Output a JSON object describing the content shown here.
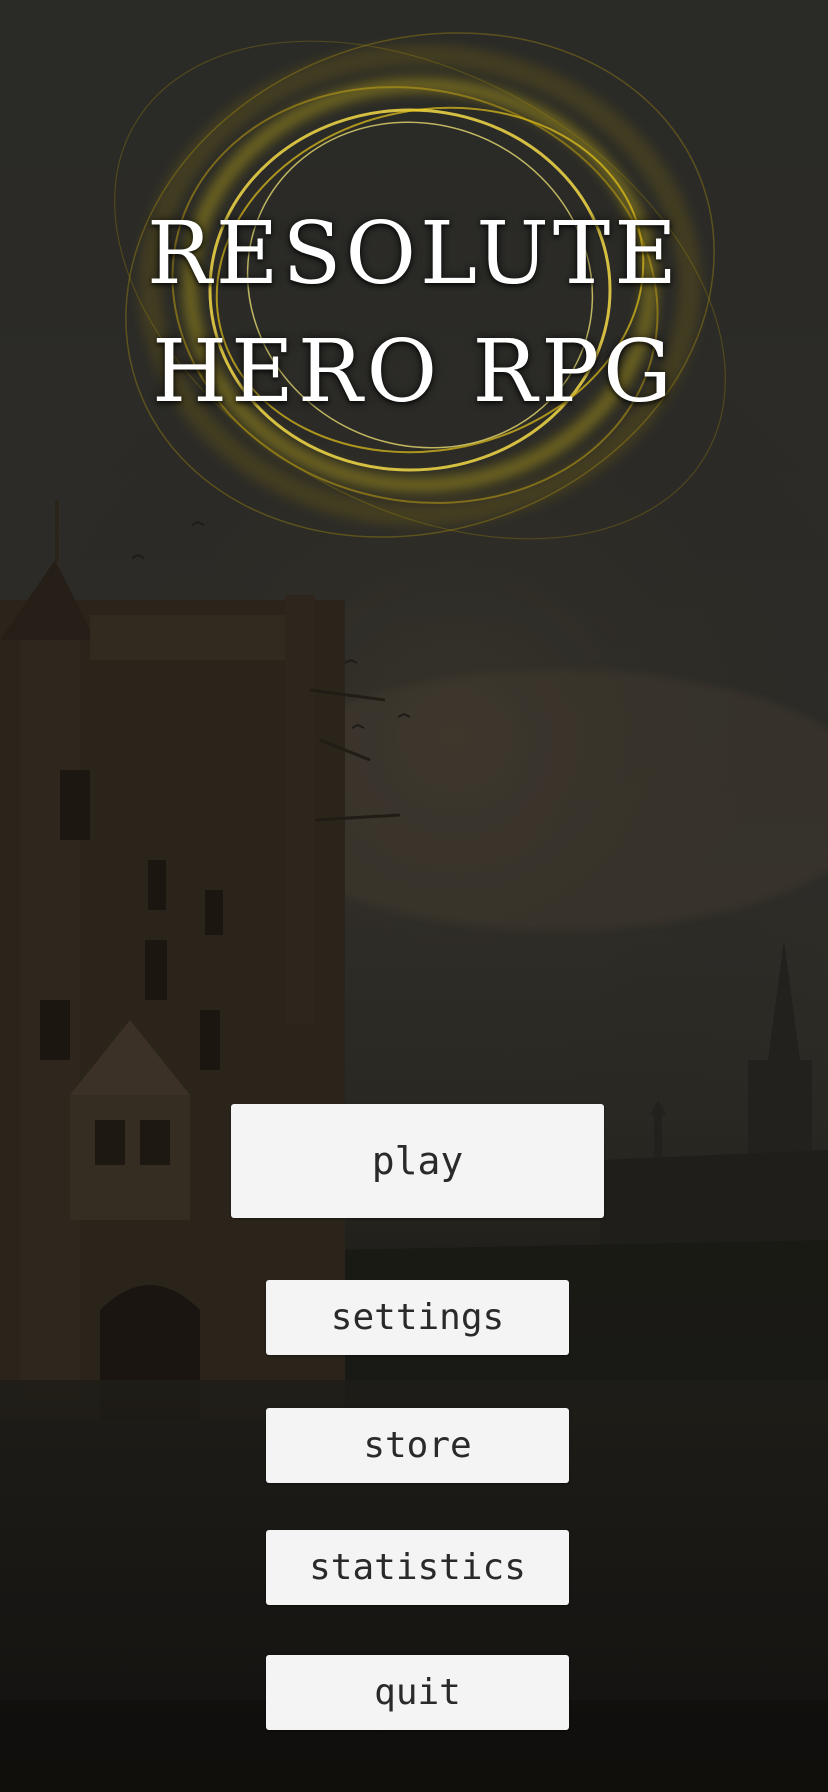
{
  "title": {
    "line1": "RESOLUTE",
    "line2": "HERO RPG"
  },
  "menu": {
    "play_label": "play",
    "settings_label": "settings",
    "store_label": "store",
    "statistics_label": "statistics",
    "quit_label": "quit"
  },
  "colors": {
    "ring_glow": "#f5d90a",
    "button_bg": "#f4f4f4",
    "button_text": "#2a2a2a",
    "title_text": "#ffffff"
  }
}
